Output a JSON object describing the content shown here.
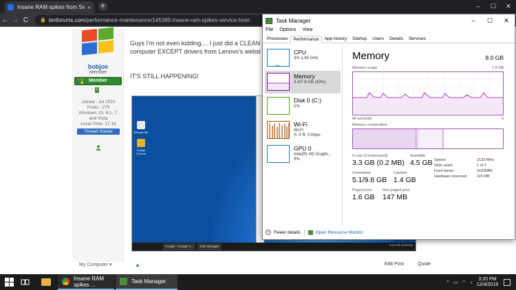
{
  "browser": {
    "tab_title": "Insane RAM spikes from Service",
    "tab_close": "×",
    "new_tab": "+",
    "url_host": "tenforums.com",
    "url_path": "/performance-maintenance/145385-insane-ram-spikes-service-host-",
    "min": "–",
    "max": "☐",
    "close": "✕",
    "back": "←",
    "forward": "→",
    "reload": "C"
  },
  "post": {
    "username": "bobjoe",
    "role": "Member",
    "member_badge": "Member",
    "rep": "0",
    "joined": "Joined : Jul 2015",
    "posts": "Posts : 275",
    "os": "Windows 10, 8.1, 7, and Vista",
    "local_time": "Local Time: 17:19",
    "thread_starter": "Thread Starter",
    "line1": "Guys I'm not even kidding.... I just did a CLEAN",
    "line2": "computer EXCEPT drivers from Lenovo's websit",
    "line3": "IT'S STILL HAPPENING!",
    "my_computer": "My Computer ▾",
    "edit_post": "Edit Post",
    "quote": "Quote"
  },
  "embedded": {
    "tb_items": [
      "Google - Google C...",
      "Task Manager"
    ],
    "clock": "3:16 PM\n12/4/2019",
    "icons": [
      "Recycle Bin",
      "Google Chrome"
    ]
  },
  "taskmgr": {
    "title": "Task Manager",
    "menu": [
      "File",
      "Options",
      "View"
    ],
    "tabs": [
      "Processes",
      "Performance",
      "App history",
      "Startup",
      "Users",
      "Details",
      "Services"
    ],
    "active_tab": "Performance",
    "side": [
      {
        "name": "CPU",
        "sub": "3% 1.65 GHz",
        "color": "#117dbb"
      },
      {
        "name": "Memory",
        "sub": "3.4/7.9 GB (43%)",
        "color": "#8b12ae"
      },
      {
        "name": "Disk 0 (C:)",
        "sub": "1%",
        "color": "#4da60c"
      },
      {
        "name": "Wi-Fi",
        "sub": "Wi-Fi\nS: 0 R: 0 Kbps",
        "color": "#a74f01"
      },
      {
        "name": "GPU 0",
        "sub": "Intel(R) HD Graphi...\n3%",
        "color": "#117dbb"
      }
    ],
    "memory": {
      "title": "Memory",
      "total": "8.0 GB",
      "usage_label": "Memory usage",
      "usage_max": "7.9 GB",
      "seconds": "60 seconds",
      "zero": "0",
      "composition_label": "Memory composition",
      "in_use_label": "In use (Compressed)",
      "in_use": "3.3 GB (0.2 MB)",
      "available_label": "Available",
      "available": "4.5 GB",
      "committed_label": "Committed",
      "committed": "5.1/9.8 GB",
      "cached_label": "Cached",
      "cached": "1.4 GB",
      "paged_label": "Paged pool",
      "paged": "1.6 GB",
      "nonpaged_label": "Non-paged pool",
      "nonpaged": "147 MB",
      "speed_label": "Speed:",
      "speed": "2133 MHz",
      "slots_label": "Slots used:",
      "slots": "1 of 2",
      "form_label": "Form factor:",
      "form": "SODIMM",
      "hwres_label": "Hardware reserved:",
      "hwres": "115 MB"
    },
    "fewer_details": "Fewer details",
    "open_monitor": "Open Resource Monitor"
  },
  "taskbar": {
    "app1": "Insane RAM spikes ...",
    "app2": "Task Manager",
    "time": "3:20 PM",
    "date": "12/4/2019"
  },
  "colors": {
    "memory_accent": "#8b12ae",
    "chrome_dark": "#202124",
    "taskbar": "#1c1c1c"
  }
}
